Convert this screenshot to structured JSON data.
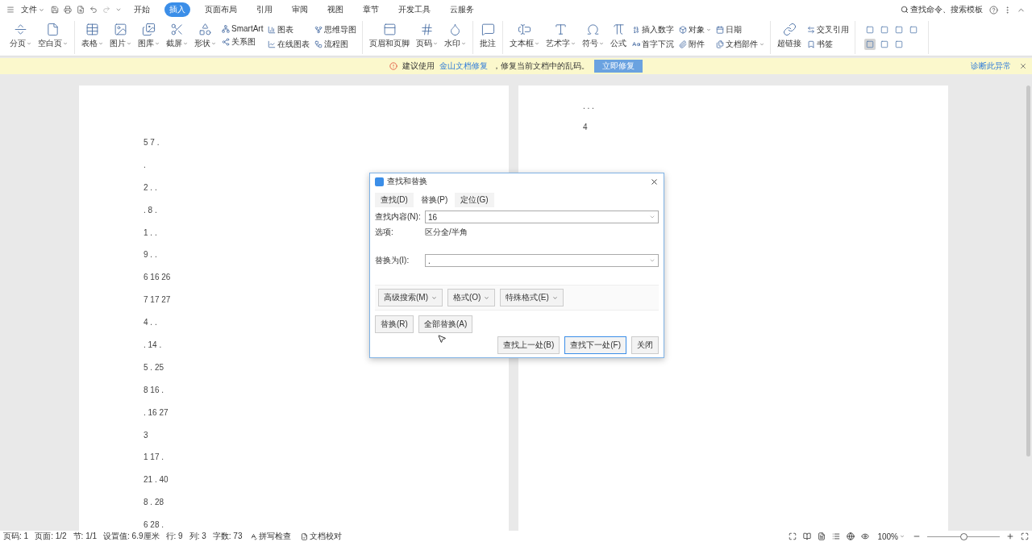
{
  "menu_bar": {
    "file_menu": "文件",
    "tabs": [
      {
        "label": "开始",
        "selected": false
      },
      {
        "label": "插入",
        "selected": true
      },
      {
        "label": "页面布局",
        "selected": false
      },
      {
        "label": "引用",
        "selected": false
      },
      {
        "label": "审阅",
        "selected": false
      },
      {
        "label": "视图",
        "selected": false
      },
      {
        "label": "章节",
        "selected": false
      },
      {
        "label": "开发工具",
        "selected": false
      },
      {
        "label": "云服务",
        "selected": false
      }
    ],
    "search": "查找命令、搜索模板"
  },
  "ribbon": {
    "groups": [
      {
        "items": [
          {
            "label": "分页",
            "dropdown": true,
            "kind": "large"
          },
          {
            "label": "空白页",
            "dropdown": true,
            "kind": "large"
          }
        ]
      },
      {
        "items": [
          {
            "label": "表格",
            "dropdown": true,
            "kind": "large"
          },
          {
            "label": "图片",
            "dropdown": true,
            "kind": "large"
          },
          {
            "label": "图库",
            "dropdown": true,
            "kind": "large"
          },
          {
            "label": "截屏",
            "dropdown": true,
            "kind": "large"
          },
          {
            "label": "形状",
            "dropdown": true,
            "kind": "large"
          },
          {
            "label": "SmartArt",
            "dropdown": false,
            "kind": "small"
          },
          {
            "label": "关系图",
            "dropdown": false,
            "kind": "small"
          },
          {
            "label": "图表",
            "dropdown": false,
            "kind": "small"
          },
          {
            "label": "在线图表",
            "dropdown": false,
            "kind": "small"
          },
          {
            "label": "思维导图",
            "dropdown": false,
            "kind": "small"
          },
          {
            "label": "流程图",
            "dropdown": false,
            "kind": "small"
          }
        ]
      },
      {
        "items": [
          {
            "label": "页眉和页脚",
            "dropdown": false,
            "kind": "large"
          },
          {
            "label": "页码",
            "dropdown": true,
            "kind": "large"
          },
          {
            "label": "水印",
            "dropdown": true,
            "kind": "large"
          }
        ]
      },
      {
        "items": [
          {
            "label": "批注",
            "dropdown": false,
            "kind": "large"
          }
        ]
      },
      {
        "items": [
          {
            "label": "文本框",
            "dropdown": true,
            "kind": "large"
          },
          {
            "label": "艺术字",
            "dropdown": true,
            "kind": "large"
          },
          {
            "label": "符号",
            "dropdown": true,
            "kind": "large"
          },
          {
            "label": "公式",
            "dropdown": false,
            "kind": "large"
          },
          {
            "label": "插入数字",
            "dropdown": false,
            "kind": "small"
          },
          {
            "label": "首字下沉",
            "dropdown": false,
            "kind": "small"
          },
          {
            "label": "对象",
            "dropdown": true,
            "kind": "small"
          },
          {
            "label": "附件",
            "dropdown": false,
            "kind": "small"
          },
          {
            "label": "日期",
            "dropdown": false,
            "kind": "small"
          },
          {
            "label": "文档部件",
            "dropdown": true,
            "kind": "small"
          }
        ]
      },
      {
        "items": [
          {
            "label": "超链接",
            "dropdown": false,
            "kind": "large"
          },
          {
            "label": "交叉引用",
            "dropdown": false,
            "kind": "small"
          },
          {
            "label": "书签",
            "dropdown": false,
            "kind": "small"
          }
        ]
      }
    ],
    "view_buttons": [
      {
        "selected": false
      },
      {
        "selected": false
      },
      {
        "selected": false
      },
      {
        "selected": false
      },
      {
        "selected": true
      },
      {
        "selected": false
      },
      {
        "selected": false
      }
    ]
  },
  "notice": {
    "before": "建议使用",
    "link": "金山文档修复",
    "after": "，修复当前文档中的乱码。",
    "button": "立即修复",
    "diagnose": "诊断此异常"
  },
  "document": {
    "left_page_lines": [
      "5 7 .",
      ".",
      "2 . .",
      ". 8 .",
      "1 . .",
      "9 . .",
      "6 16 26",
      "7 17 27",
      "4 . .",
      ". 14 .",
      "5 . 25",
      "8 16 .",
      ". 16 27",
      "3",
      "1 17 .",
      "21 . 40",
      "8 . 28",
      "6 28 ."
    ],
    "right_page_lines": [
      ". . .",
      "4"
    ]
  },
  "dialog": {
    "title": "查找和替换",
    "tabs": [
      {
        "label": "查找(D)",
        "selected": false
      },
      {
        "label": "替换(P)",
        "selected": true
      },
      {
        "label": "定位(G)",
        "selected": false
      }
    ],
    "find_label": "查找内容(N):",
    "find_value": "16",
    "options_label": "选项:",
    "options_value": "区分全/半角",
    "replace_label": "替换为(I):",
    "replace_value": ".",
    "option_buttons": [
      "高级搜索(M)",
      "格式(O)",
      "特殊格式(E)"
    ],
    "left_buttons": [
      "替换(R)",
      "全部替换(A)"
    ],
    "right_buttons": [
      {
        "label": "查找上一处(B)",
        "selected": false
      },
      {
        "label": "查找下一处(F)",
        "selected": true
      },
      {
        "label": "关闭",
        "selected": false
      }
    ]
  },
  "status_bar": {
    "items": [
      "页码: 1",
      "页面: 1/2",
      "节: 1/1",
      "设置值: 6.9厘米",
      "行: 9",
      "列: 3",
      "字数: 73"
    ],
    "spell_check": "拼写检查",
    "proofread": "文档校对",
    "zoom": "100%",
    "level": 0.5
  }
}
